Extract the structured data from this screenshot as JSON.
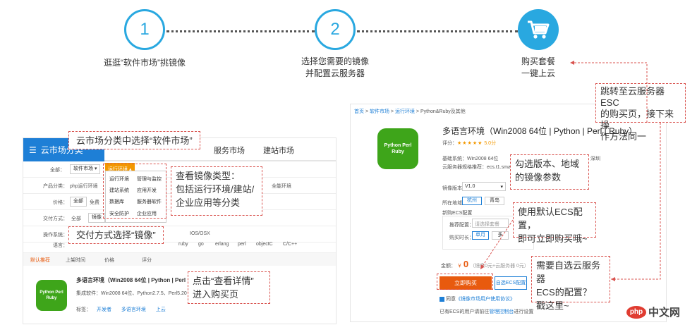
{
  "steps": [
    {
      "number": "1",
      "text_line1": "逛逛“软件市场”挑镜像",
      "text_line2": ""
    },
    {
      "number": "2",
      "text_line1": "选择您需要的镜像",
      "text_line2": "并配置云服务器"
    },
    {
      "number": "",
      "text_line1": "购买套餐",
      "text_line2": "一键上云"
    }
  ],
  "callouts": {
    "choose_market": "云市场分类中选择“软件市场”",
    "image_types_1": "查看镜像类型：",
    "image_types_2": "包括运行环境/建站/",
    "image_types_3": "企业应用等分类",
    "delivery_image": "交付方式选择“镜像”",
    "view_detail_1": "点击“查看详情”",
    "view_detail_2": "进入购买页",
    "jump_esc_1": "跳转至云服务器ESC",
    "jump_esc_2": "的购买页，接下来操",
    "jump_esc_3": "作方法同一",
    "select_version_1": "勾选版本、地域",
    "select_version_2": "的镜像参数",
    "default_ecs_1": "使用默认ECS配置，",
    "default_ecs_2": "即可立即购买哦~",
    "custom_ecs_1": "需要自选云服务器",
    "custom_ecs_2": "ECS的配置？",
    "custom_ecs_3": "戳这里~"
  },
  "market": {
    "category_label": "云市场分类",
    "tabs": [
      "服务市场",
      "建站市场"
    ],
    "all_label": "全部：",
    "software_market": "软件市场",
    "runtime_env": "运行环境",
    "dropdown_items": [
      "运行环境",
      "管理与监控",
      "建站系统",
      "应用开发",
      "数据库",
      "服务器软件",
      "安全防护",
      "企业应用"
    ],
    "product_category_label": "产品分类：",
    "product_category_value": "php运行环境",
    "full_env": "全能环境",
    "price_label": "价格：",
    "price_all": "全部",
    "price_free": "免费",
    "delivery_label": "交付方式：",
    "delivery_all": "全部",
    "delivery_image": "镜像",
    "os_label": "操作系统：",
    "os_value": "IOS/OSX",
    "lang_label": "语言：",
    "langs": [
      "ruby",
      "go",
      "erlang",
      "perl",
      "objectC",
      "C/C++"
    ],
    "sort_items": [
      "默认推荐",
      "上架时间",
      "价格",
      "评分"
    ],
    "product_title": "多语言环境（Win2008 64位 | Python | Perl |",
    "product_integrated": "集成软件：Win2008 64位、Python2.7.5、Perl5.20",
    "tags_label": "标签：",
    "tags": [
      "开发者",
      "多语言环境",
      "上云"
    ],
    "logo_text": "Python Perl Ruby"
  },
  "detail": {
    "breadcrumb": [
      "首页",
      "软件市场",
      "运行环境",
      "Python&Ruby及其他"
    ],
    "title": "多语言环境（Win2008 64位 | Python | Perl | Ruby）",
    "rating_label": "评分：",
    "rating_score": "5.0分",
    "base_system": "基础系统：Win2008 64位",
    "server_spec": "云服务器规格推荐：ecs.t1.small 配置",
    "shenzhen": "深圳",
    "image_version_label": "镜像版本：",
    "image_version_value": "V1.0",
    "region_label": "所在地域：",
    "regions": [
      "杭州",
      "青岛"
    ],
    "new_ecs_label": "新购ECS配置",
    "recommend_label": "推荐配置：",
    "recommend_placeholder": "请选择套餐",
    "duration_label": "购买时长：",
    "duration_options": [
      "单月",
      "多"
    ],
    "amount_label": "金额：",
    "amount_currency": "￥",
    "amount_value": "0",
    "amount_note": "（镜像0元+云服务器 0元）",
    "buy_now": "立即购买",
    "custom_ecs": "自选ECS配置",
    "agree_prefix": "同意",
    "agree_link": "《镜像市场用户使用协议》",
    "ecs_note": "已有ECS的用户请前往",
    "ecs_link": "管理控制台",
    "ecs_note_suffix": "进行设置",
    "logo_text": "Python Perl Ruby"
  },
  "watermark": {
    "brand": "php",
    "site": "中文网"
  },
  "colors": {
    "step_blue": "#29a8e0",
    "market_blue": "#1e7fd6",
    "orange": "#f39800",
    "buy_red": "#e85a0e",
    "logo_green": "#3ea51a",
    "callout_red": "#d9534f"
  }
}
